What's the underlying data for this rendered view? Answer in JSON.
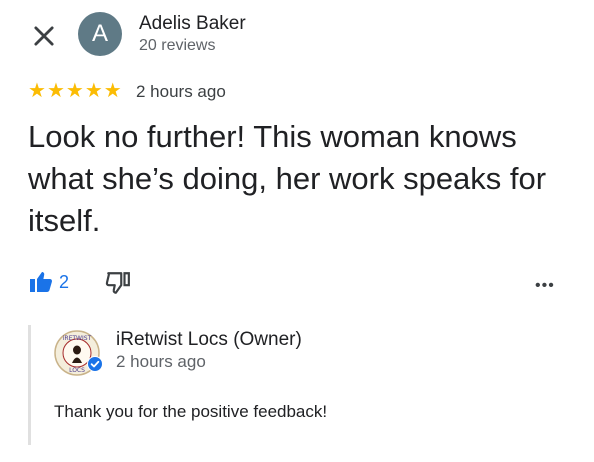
{
  "header": {
    "close_icon": "close-icon",
    "avatar_letter": "A",
    "reviewer_name": "Adelis Baker",
    "reviewer_reviews": "20 reviews"
  },
  "rating": {
    "stars": 5,
    "star_color": "#fbbc04",
    "time": "2 hours ago"
  },
  "review": {
    "text": "Look no further! This woman knows what she’s doing, her work speaks for itself."
  },
  "actions": {
    "like_count": "2",
    "like_icon": "thumbs-up-icon",
    "dislike_icon": "thumbs-down-icon",
    "more_icon": "more-horizontal-icon",
    "accent_color": "#1a73e8"
  },
  "owner_response": {
    "owner_name": "iRetwist Locs (Owner)",
    "time": "2 hours ago",
    "text": "Thank you for the positive feedback!",
    "logo_text_top": "iRETWIST",
    "logo_text_bottom": "LOCS",
    "verified_icon": "verified-check-icon"
  }
}
